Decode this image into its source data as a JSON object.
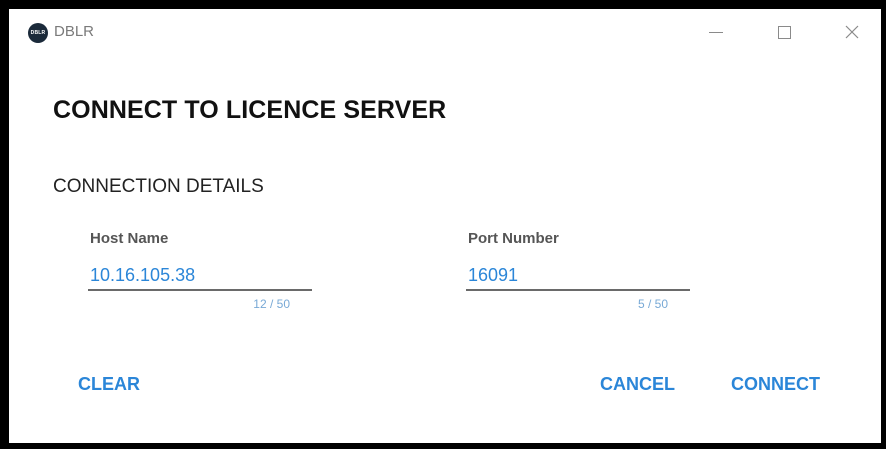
{
  "window": {
    "app_icon_text": "DBLR",
    "title": "DBLR",
    "minimize_icon": "minimize-icon",
    "maximize_icon": "maximize-icon",
    "close_icon": "close-icon",
    "close_glyph": "✕"
  },
  "dialog": {
    "heading": "CONNECT TO LICENCE SERVER",
    "section_title": "CONNECTION DETAILS"
  },
  "host": {
    "label": "Host Name",
    "value": "10.16.105.38",
    "counter": "12 / 50"
  },
  "port": {
    "label": "Port Number",
    "value": "16091",
    "counter": "5 / 50"
  },
  "actions": {
    "clear": "CLEAR",
    "cancel": "CANCEL",
    "connect": "CONNECT"
  },
  "colors": {
    "accent": "#2b86d8",
    "counter": "#78a9d6",
    "text": "#111111"
  }
}
